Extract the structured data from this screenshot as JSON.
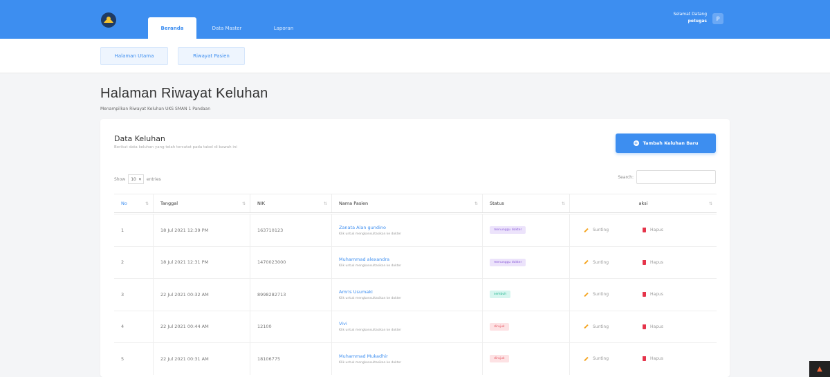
{
  "topbar": {
    "tabs": [
      "Beranda",
      "Data Master",
      "Laporan"
    ],
    "user_greeting": "Selamat Datang",
    "user_name": "petugas",
    "avatar_letter": "P",
    "color": "#3d8ef0"
  },
  "subnav": {
    "items": [
      "Halaman Utama",
      "Riwayat Pasien"
    ]
  },
  "page": {
    "title": "Halaman Riwayat Keluhan",
    "subtitle": "Menampilkan Riwayat Keluhan UKS SMAN 1 Pandaan"
  },
  "card": {
    "title": "Data Keluhan",
    "description": "Berikut data keluhan yang telah tercatat pada tabel di bawah ini",
    "add_button": "Tambah Keluhan Baru",
    "show_label": "Show",
    "show_value": "10",
    "entries_label": "entries",
    "search_label": "Search:"
  },
  "table": {
    "headers": [
      "No",
      "Tanggal",
      "NIK",
      "Nama Pasien",
      "Status",
      "aksi"
    ],
    "rows": [
      {
        "no": "1",
        "tanggal": "18 Jul 2021 12:39 PM",
        "nik": "163710123",
        "nama": "Zanata Alan gundino",
        "hint": "Klik untuk mengkonsultasikan ke dokter",
        "status": "menunggu dokter",
        "status_style": "purple"
      },
      {
        "no": "2",
        "tanggal": "18 Jul 2021 12:31 PM",
        "nik": "1470023000",
        "nama": "Muhammad alexandra",
        "hint": "Klik untuk mengkonsultasikan ke dokter",
        "status": "menunggu dokter",
        "status_style": "purple"
      },
      {
        "no": "3",
        "tanggal": "22 Jul 2021 00:32 AM",
        "nik": "8998282713",
        "nama": "Amris Usumaki",
        "hint": "Klik untuk mengkonsultasikan ke dokter",
        "status": "sembuh",
        "status_style": "teal"
      },
      {
        "no": "4",
        "tanggal": "22 Jul 2021 00:44 AM",
        "nik": "12100",
        "nama": "Vivi",
        "hint": "Klik untuk mengkonsultasikan ke dokter",
        "status": "dirujuk",
        "status_style": "red"
      },
      {
        "no": "5",
        "tanggal": "22 Jul 2021 00:31 AM",
        "nik": "18106775",
        "nama": "Muhammad Mukadhir",
        "hint": "Klik untuk mengkonsultasikan ke dokter",
        "status": "dirujuk",
        "status_style": "red"
      }
    ],
    "edit_label": "Sunting",
    "delete_label": "Hapus"
  }
}
